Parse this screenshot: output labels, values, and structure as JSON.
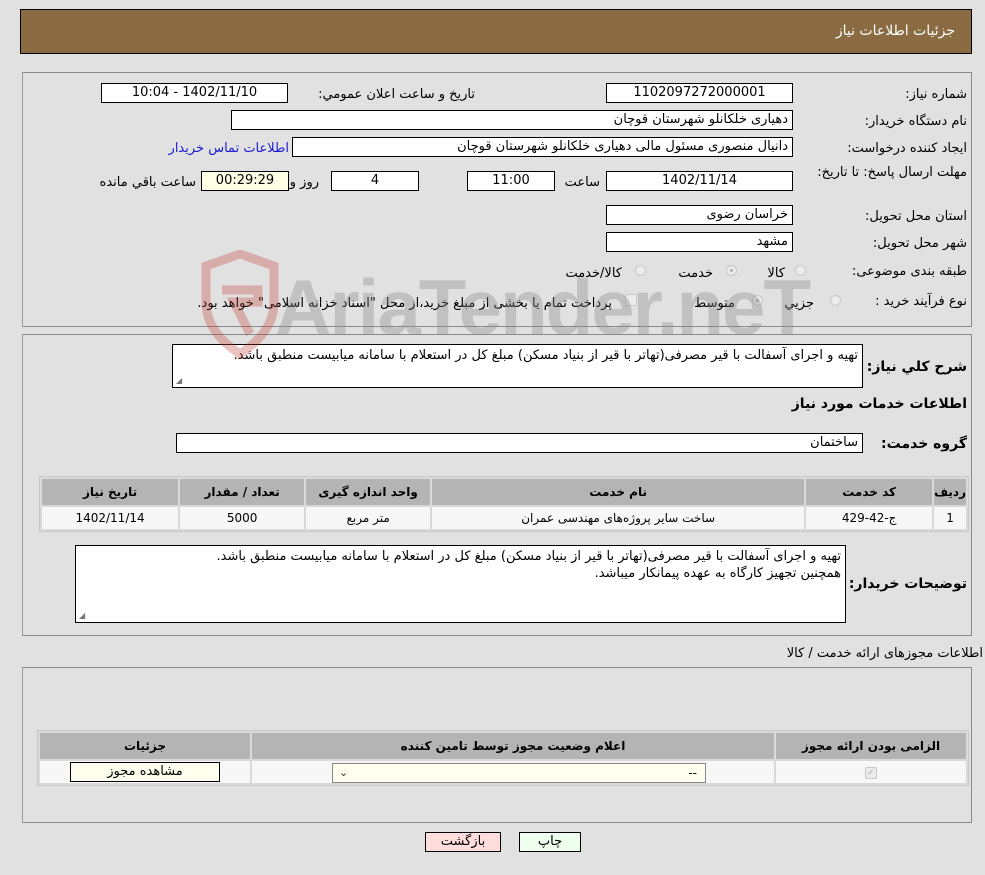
{
  "header": {
    "title": "جزئیات اطلاعات نیاز"
  },
  "need_info": {
    "need_number_label": "شماره نیاز:",
    "need_number": "1102097272000001",
    "announce_label": "تاریخ و ساعت اعلان عمومي:",
    "announce_value": "1402/11/10 - 10:04",
    "buyer_org_label": "نام دستگاه خریدار:",
    "buyer_org": "دهیاری خلکانلو شهرستان قوچان",
    "creator_label": "ایجاد کننده درخواست:",
    "creator": "دانیال منصوری مسئول مالی دهیاری خلکانلو شهرستان قوچان",
    "contact_link": "اطلاعات تماس خریدار",
    "deadline_label": "مهلت ارسال پاسخ: تا تاریخ:",
    "deadline_date": "1402/11/14",
    "time_label": "ساعت",
    "deadline_time": "11:00",
    "days_value": "4",
    "days_label": "روز و",
    "remaining_time": "00:29:29",
    "remaining_label": "ساعت باقي مانده",
    "province_label": "استان محل تحویل:",
    "province": "خراسان رضوی",
    "city_label": "شهر محل تحویل:",
    "city": "مشهد",
    "category_label": "طبقه بندی موضوعی:",
    "category_options": [
      {
        "label": "کالا",
        "selected": false
      },
      {
        "label": "خدمت",
        "selected": true
      },
      {
        "label": "کالا/خدمت",
        "selected": false
      }
    ],
    "process_label": "نوع فرآیند خرید :",
    "process_options": [
      {
        "label": "جزیي",
        "selected": false
      },
      {
        "label": "متوسط",
        "selected": true
      }
    ],
    "treasury_checkbox_label": "پرداخت تمام یا بخشی از مبلغ خرید،از محل \"اسناد خزانه اسلامی\" خواهد بود.",
    "treasury_checked": false
  },
  "description": {
    "label": "شرح کلي نیاز:",
    "text": "تهیه و اجرای آسفالت با قیر مصرفی(تهاتر با قیر از بنیاد مسکن) مبلغ کل در استعلام با سامانه میابیست منطبق باشد."
  },
  "services": {
    "section_title": "اطلاعات خدمات مورد نیاز",
    "group_label": "گروه خدمت:",
    "group_value": "ساختمان",
    "columns": [
      "ردیف",
      "کد خدمت",
      "نام خدمت",
      "واحد اندازه گیری",
      "تعداد / مقدار",
      "تاریخ نیاز"
    ],
    "rows": [
      {
        "row": "1",
        "code": "ج-42-429",
        "name": "ساخت سایر پروژه‌های مهندسی عمران",
        "unit": "متر مربع",
        "qty": "5000",
        "date": "1402/11/14"
      }
    ]
  },
  "buyer_notes": {
    "label": "توضیحات خریدار:",
    "line1": "تهیه و اجرای آسفالت با قیر مصرفی(تهاتر با قیر از بنیاد مسکن) مبلغ کل در استعلام با سامانه میابیست منطبق باشد.",
    "line2": "همچنین تجهیز کارگاه به عهده پیمانکار میباشد."
  },
  "permits": {
    "section_title": "اطلاعات مجوزهای ارائه خدمت / کالا",
    "columns": [
      "الزامی بودن ارائه مجوز",
      "اعلام وضعیت مجوز توسط تامین کننده",
      "جزئیات"
    ],
    "rows": [
      {
        "required_checked": true,
        "status_selected": "--",
        "details_button": "مشاهده مجوز"
      }
    ]
  },
  "footer": {
    "print_button": "چاپ",
    "back_button": "بازگشت"
  },
  "watermark": {
    "text": "AriaTender.neT"
  }
}
